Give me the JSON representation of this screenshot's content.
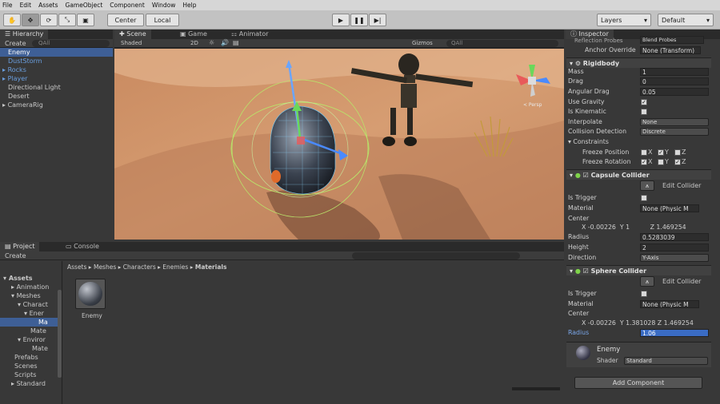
{
  "menu": [
    "File",
    "Edit",
    "Assets",
    "GameObject",
    "Component",
    "Window",
    "Help"
  ],
  "toolbar": {
    "pivot": "Center",
    "space": "Local",
    "layers": "Layers",
    "layout": "Default"
  },
  "hierarchy": {
    "tab": "Hierarchy",
    "create": "Create",
    "search": "All",
    "items": [
      "Enemy",
      "DustStorm",
      "Rocks",
      "Player",
      "Directional Light",
      "Desert",
      "CameraRig"
    ]
  },
  "scene": {
    "tabs": [
      "Scene",
      "Game",
      "Animator"
    ],
    "shading": "Shaded",
    "mode2d": "2D",
    "gizmos": "Gizmos",
    "search": "All",
    "persp": "< Persp"
  },
  "project": {
    "tabs": [
      "Project",
      "Console"
    ],
    "create": "Create",
    "tree": [
      "Assets",
      "Animation",
      "Meshes",
      "Charact",
      "Ener",
      "Ma",
      "Mate",
      "Enviror",
      "Mate",
      "Prefabs",
      "Scenes",
      "Scripts",
      "Standard"
    ],
    "breadcrumb": [
      "Assets",
      "Meshes",
      "Characters",
      "Enemies",
      "Materials"
    ],
    "asset": "Enemy"
  },
  "inspector": {
    "tab": "Inspector",
    "reflection": "Reflection Probes",
    "reflection_val": "Blend Probes",
    "anchor": "Anchor Override",
    "anchor_val": "None (Transform)",
    "rigidbody": {
      "title": "Rigidbody",
      "mass_l": "Mass",
      "mass": "1",
      "drag_l": "Drag",
      "drag": "0",
      "adrag_l": "Angular Drag",
      "adrag": "0.05",
      "grav_l": "Use Gravity",
      "kin_l": "Is Kinematic",
      "interp_l": "Interpolate",
      "interp": "None",
      "coll_l": "Collision Detection",
      "coll": "Discrete",
      "cons_l": "Constraints",
      "fpos_l": "Freeze Position",
      "frot_l": "Freeze Rotation",
      "x": "X",
      "y": "Y",
      "z": "Z"
    },
    "capsule": {
      "title": "Capsule Collider",
      "edit": "Edit Collider",
      "trig_l": "Is Trigger",
      "mat_l": "Material",
      "mat": "None (Physic M",
      "center_l": "Center",
      "cx": "-0.00226",
      "cy": "1",
      "cz": "1.469254",
      "rad_l": "Radius",
      "rad": "0.5283039",
      "h_l": "Height",
      "h": "2",
      "dir_l": "Direction",
      "dir": "Y-Axis"
    },
    "sphere": {
      "title": "Sphere Collider",
      "edit": "Edit Collider",
      "trig_l": "Is Trigger",
      "mat_l": "Material",
      "mat": "None (Physic M",
      "center_l": "Center",
      "cx": "-0.00226",
      "cy": "1.381028",
      "cz": "1.469254",
      "rad_l": "Radius",
      "rad": "1.06"
    },
    "material": {
      "name": "Enemy",
      "shader_l": "Shader",
      "shader": "Standard"
    },
    "add": "Add Component"
  }
}
